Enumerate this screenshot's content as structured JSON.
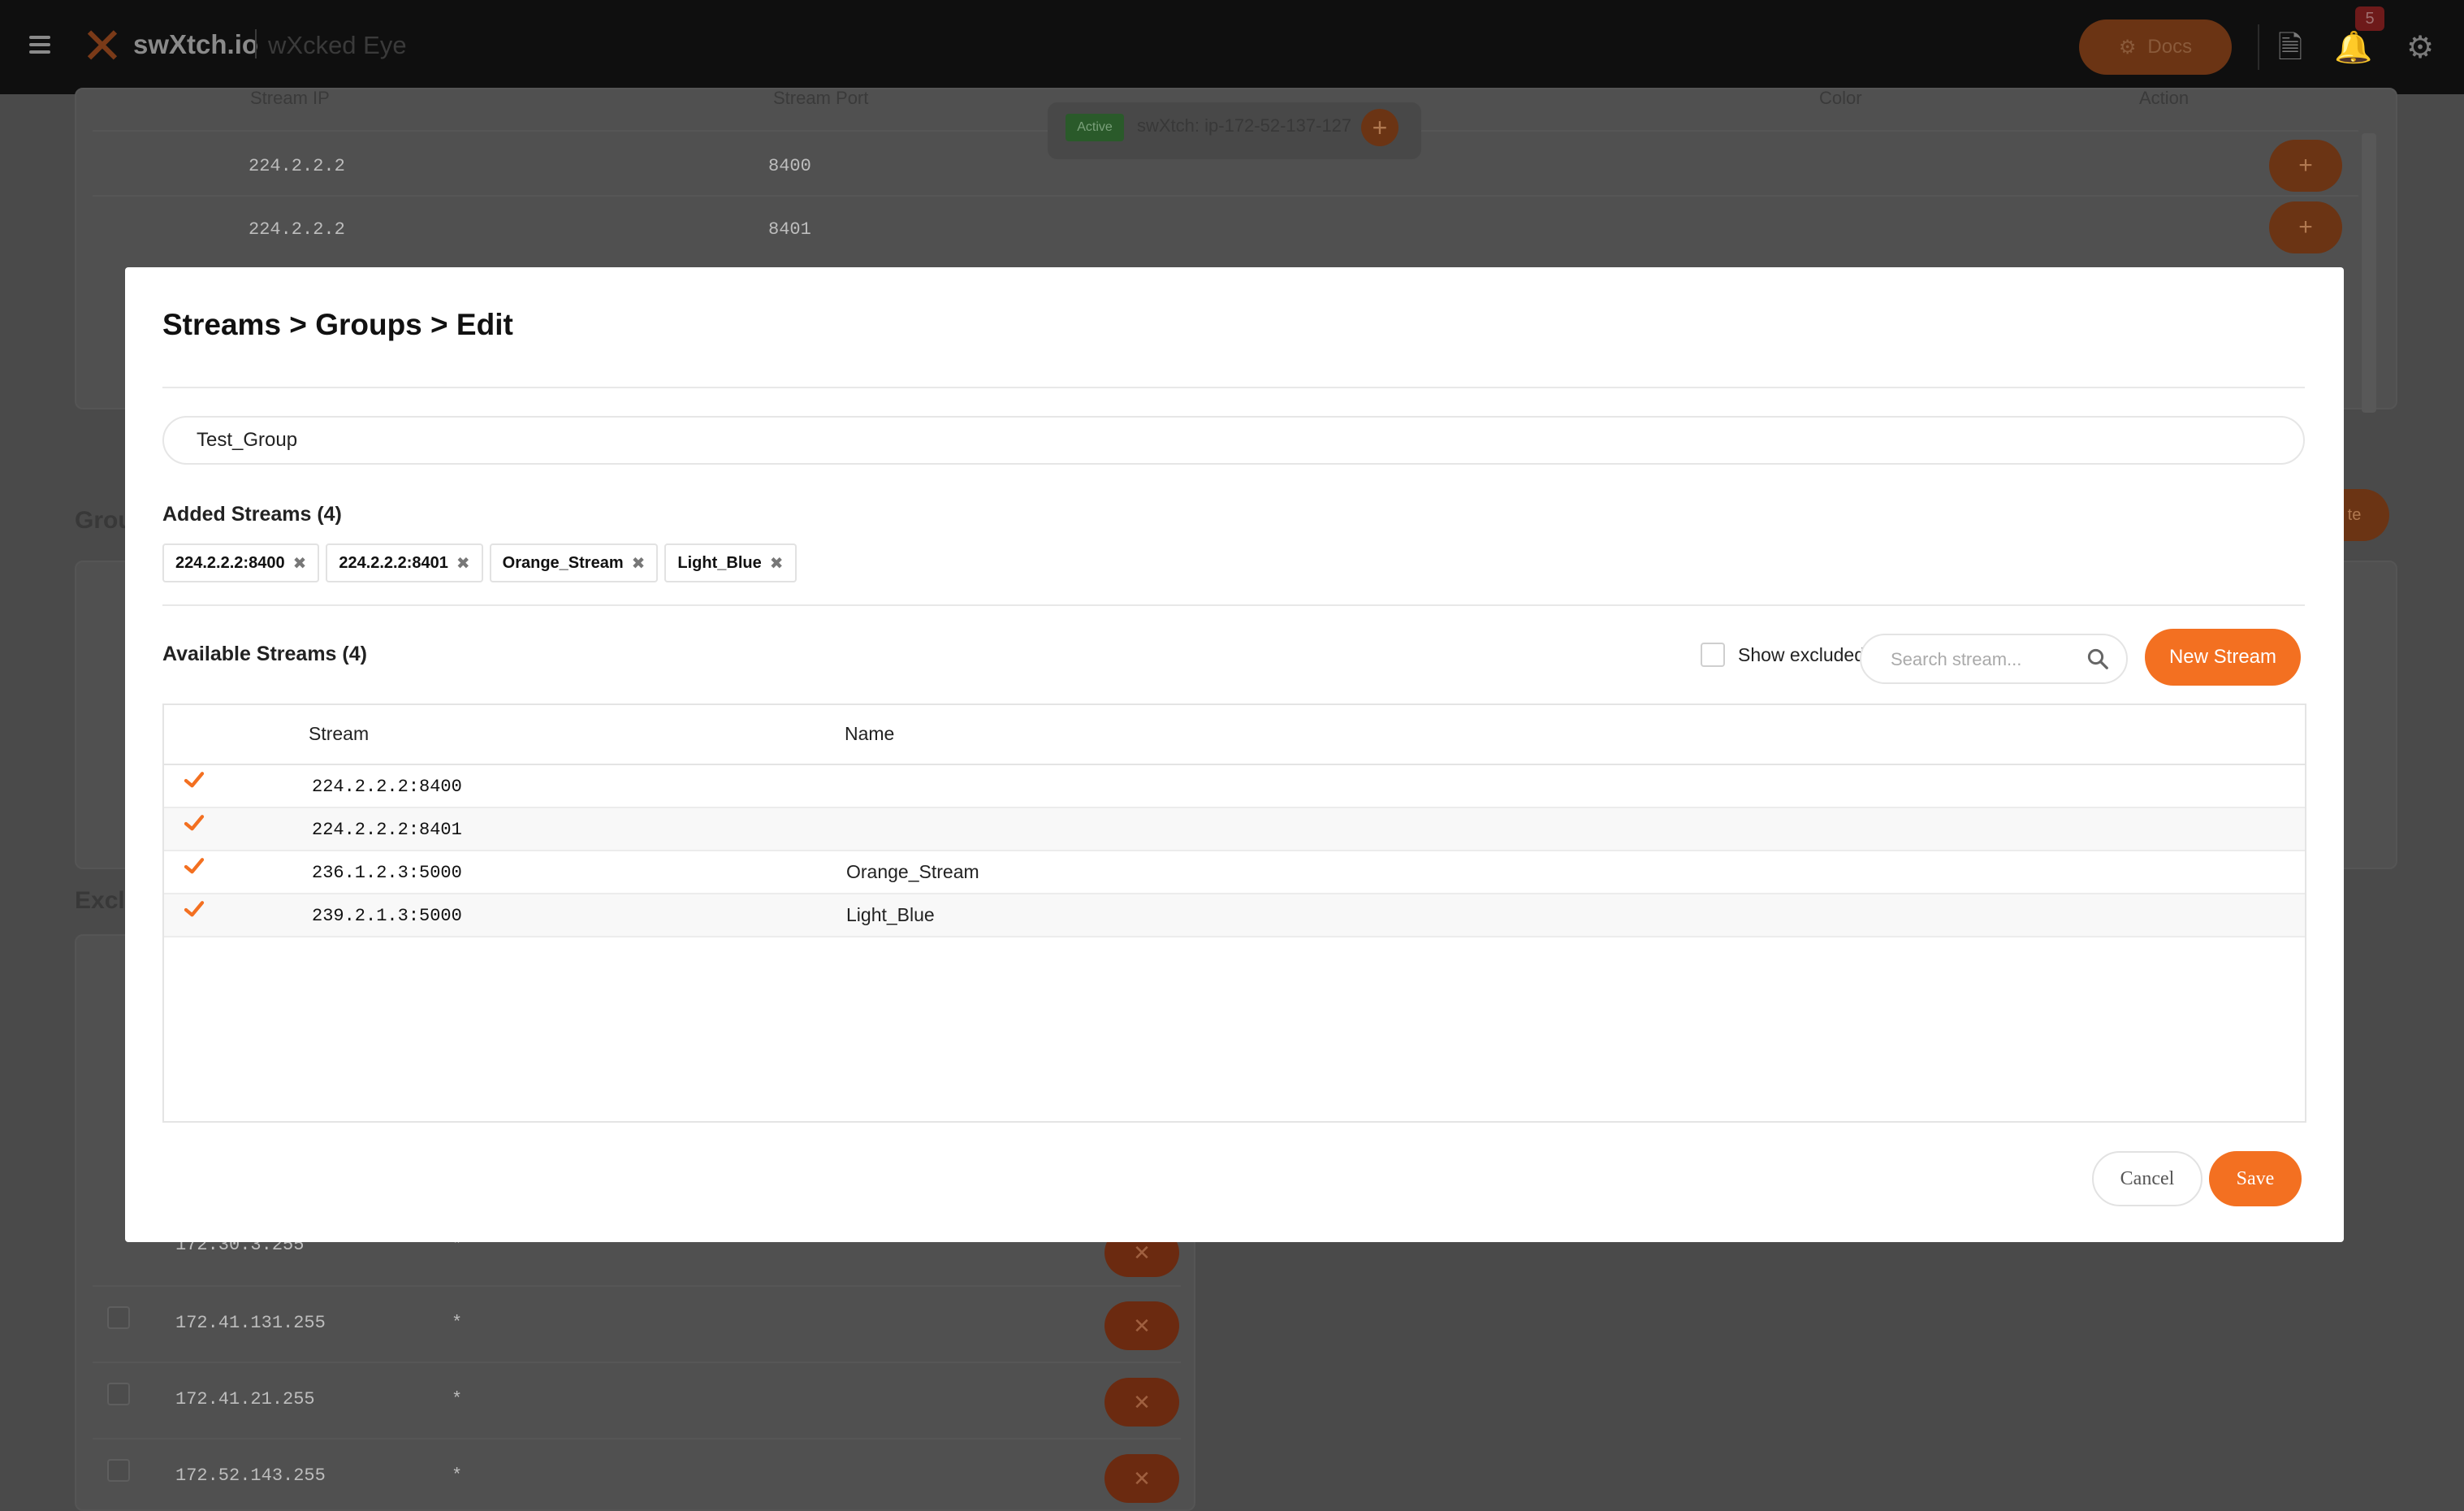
{
  "topbar": {
    "brand": "swXtch.io",
    "subtitle": "wXcked Eye",
    "docs_label": "Docs",
    "notification_count": "5"
  },
  "background": {
    "streams_table": {
      "headers": [
        "Stream IP",
        "Stream Port",
        "Color",
        "Action"
      ],
      "rows": [
        {
          "ip": "224.2.2.2",
          "port": "8400"
        },
        {
          "ip": "224.2.2.2",
          "port": "8401"
        }
      ]
    },
    "swxtch_badge": {
      "status": "Active",
      "label": "swXtch: ip-172-52-137-127"
    },
    "groups_section_label": "Grou",
    "excluded_section_label": "Exclu",
    "excluded_rows": [
      {
        "ip": "172.30.3.255",
        "port": "*"
      },
      {
        "ip": "172.41.131.255",
        "port": "*"
      },
      {
        "ip": "172.41.21.255",
        "port": "*"
      },
      {
        "ip": "172.52.143.255",
        "port": "*"
      }
    ],
    "create_btn_fragment": "te"
  },
  "modal": {
    "title": "Streams > Groups > Edit",
    "group_name": "Test_Group",
    "added_label": "Added Streams (4)",
    "added_streams": [
      "224.2.2.2:8400",
      "224.2.2.2:8401",
      "Orange_Stream",
      "Light_Blue"
    ],
    "available_label": "Available Streams (4)",
    "show_excluded_label": "Show excluded streams",
    "search_placeholder": "Search stream...",
    "new_stream_label": "New Stream",
    "table": {
      "headers": {
        "stream": "Stream",
        "name": "Name"
      },
      "rows": [
        {
          "stream": "224.2.2.2:8400",
          "name": "",
          "checked": true
        },
        {
          "stream": "224.2.2.2:8401",
          "name": "",
          "checked": true
        },
        {
          "stream": "236.1.2.3:5000",
          "name": "Orange_Stream",
          "checked": true
        },
        {
          "stream": "239.2.1.3:5000",
          "name": "Light_Blue",
          "checked": true
        }
      ]
    },
    "cancel_label": "Cancel",
    "save_label": "Save"
  },
  "colors": {
    "accent": "#f37021",
    "overlay": "#4a4a4a"
  }
}
